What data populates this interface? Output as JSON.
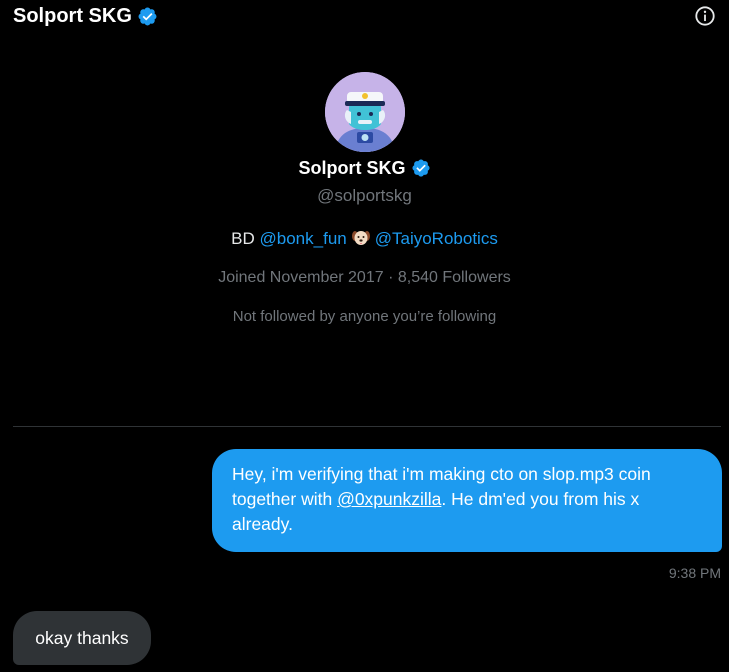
{
  "header": {
    "title": "Solport SKG",
    "verified_icon": "verified-badge-icon",
    "info_icon": "info-icon"
  },
  "profile": {
    "name": "Solport SKG",
    "handle": "@solportskg",
    "bio": {
      "prefix": "BD",
      "mention1": "@bonk_fun",
      "emoji": "dog-face-emoji",
      "mention2": "@TaiyoRobotics"
    },
    "joined": "Joined November 2017 · 8,540 Followers",
    "not_followed": "Not followed by anyone you’re following"
  },
  "messages": [
    {
      "direction": "outgoing",
      "text_before": "Hey, i'm verifying that i'm making cto on slop.mp3 coin together with ",
      "mention": "@0xpunkzilla",
      "text_after": ". He dm'ed you from his x already.",
      "time": "9:38 PM"
    },
    {
      "direction": "incoming",
      "text": "okay thanks"
    }
  ],
  "colors": {
    "accent": "#1d9bf0",
    "background": "#000000",
    "incoming_bubble": "#2f3336",
    "muted": "#71767b"
  }
}
